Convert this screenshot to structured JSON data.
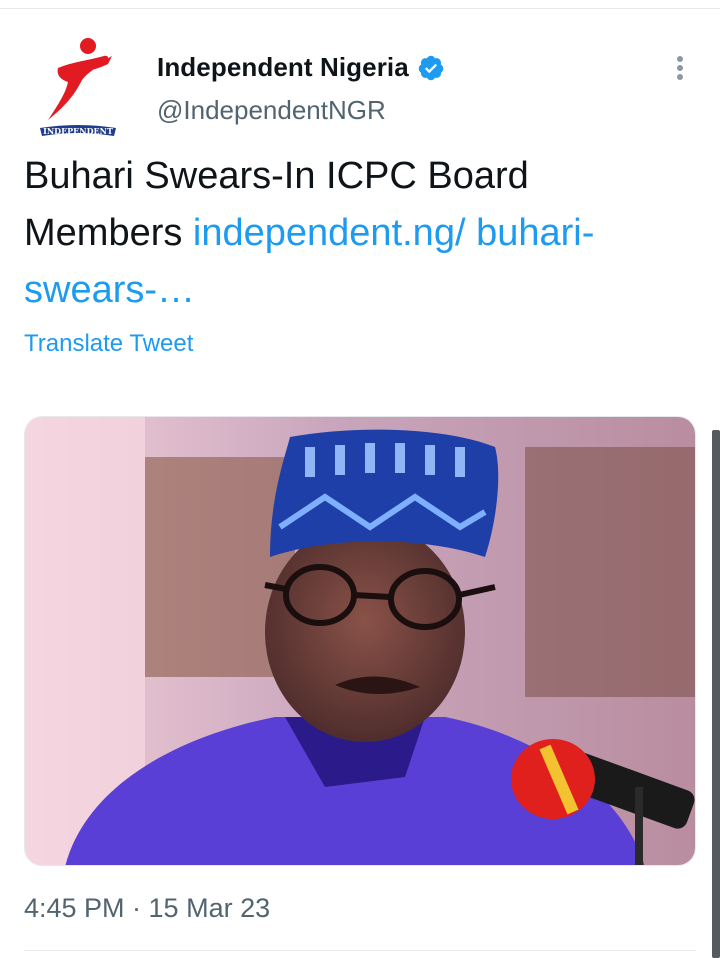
{
  "account": {
    "name": "Independent Nigeria",
    "handle": "@IndependentNGR",
    "verified": true,
    "avatar_icon": "independent-logo-icon",
    "avatar_logo_text": "INDEPENDENT"
  },
  "tweet": {
    "text": "Buhari Swears-In ICPC Board Members ",
    "link_text": "independent.ng/ buhari-swears-…",
    "translate_label": "Translate Tweet",
    "timestamp": "4:45 PM · 15 Mar 23"
  },
  "media": {
    "description_icon": "news-photo-image"
  },
  "colors": {
    "link": "#1d9bf0",
    "text": "#0f1419",
    "muted": "#536471",
    "verified": "#1d9bf0",
    "logo_red": "#e21b23"
  },
  "icons": {
    "verified": "verified-badge-icon",
    "more": "more-options-icon"
  }
}
